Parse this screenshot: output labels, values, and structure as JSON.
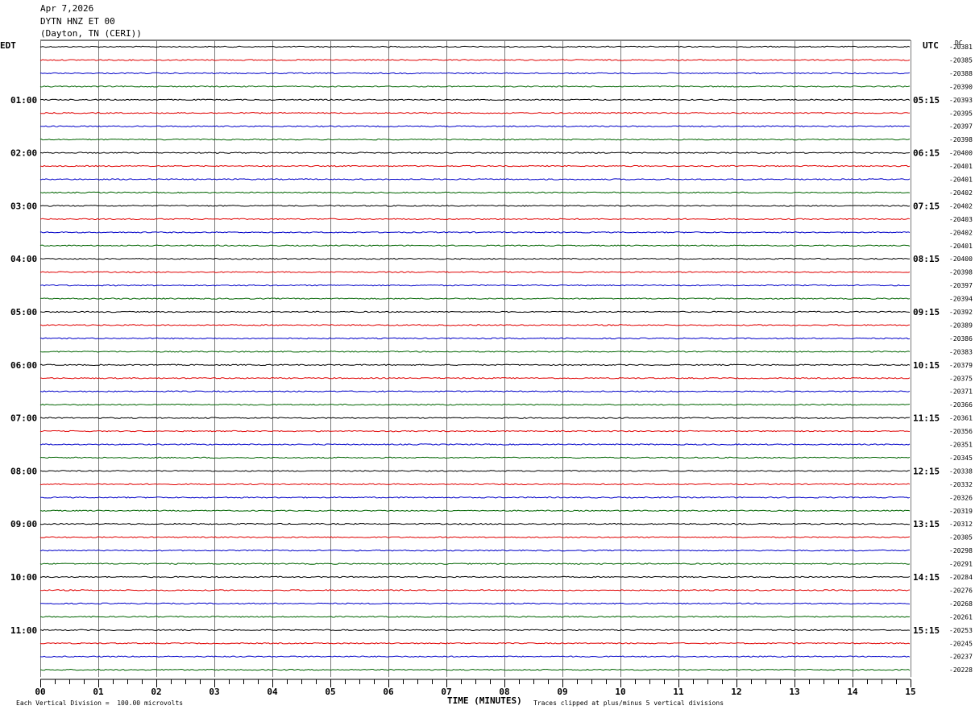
{
  "header": {
    "date": "Apr 7,2026",
    "station": "DYTN HNZ ET 00",
    "location": "(Dayton, TN (CERI))"
  },
  "left_axis_title": "EDT",
  "right_axis_title": "UTC",
  "dc_label": "DC",
  "footer": {
    "scale_note": "Each Vertical Division =  100.00 microvolts",
    "xlabel": "TIME (MINUTES)",
    "clip_note": "Traces clipped at plus/minus 5 vertical divisions"
  },
  "colors": {
    "trace_cycle": [
      "#000000",
      "#e00000",
      "#0000c8",
      "#006400"
    ],
    "grid_vertical": "#7a7a7a"
  },
  "chart_data": {
    "type": "line",
    "title": "DYTN HNZ ET 00",
    "xlabel": "TIME (MINUTES)",
    "x_ticks": [
      "00",
      "01",
      "02",
      "03",
      "04",
      "05",
      "06",
      "07",
      "08",
      "09",
      "10",
      "11",
      "12",
      "13",
      "14",
      "15"
    ],
    "xlim": [
      0,
      15
    ],
    "minor_ticks_per_minute": 4,
    "traces_per_hour": 4,
    "left_hour_labels": [
      "01:00",
      "02:00",
      "03:00",
      "04:00",
      "05:00",
      "06:00",
      "07:00",
      "08:00",
      "09:00",
      "10:00",
      "11:00"
    ],
    "right_hour_labels": [
      "05:15",
      "06:15",
      "07:15",
      "08:15",
      "09:15",
      "10:15",
      "11:15",
      "12:15",
      "13:15",
      "14:15",
      "15:15"
    ],
    "dc_offsets": [
      "-20381",
      "-20385",
      "-20388",
      "-20390",
      "-20393",
      "-20395",
      "-20397",
      "-20398",
      "-20400",
      "-20401",
      "-20401",
      "-20402",
      "-20402",
      "-20403",
      "-20402",
      "-20401",
      "-20400",
      "-20398",
      "-20397",
      "-20394",
      "-20392",
      "-20389",
      "-20386",
      "-20383",
      "-20379",
      "-20375",
      "-20371",
      "-20366",
      "-20361",
      "-20356",
      "-20351",
      "-20345",
      "-20338",
      "-20332",
      "-20326",
      "-20319",
      "-20312",
      "-20305",
      "-20298",
      "-20291",
      "-20284",
      "-20276",
      "-20268",
      "-20261",
      "-20253",
      "-20245",
      "-20237",
      "-20228"
    ]
  }
}
